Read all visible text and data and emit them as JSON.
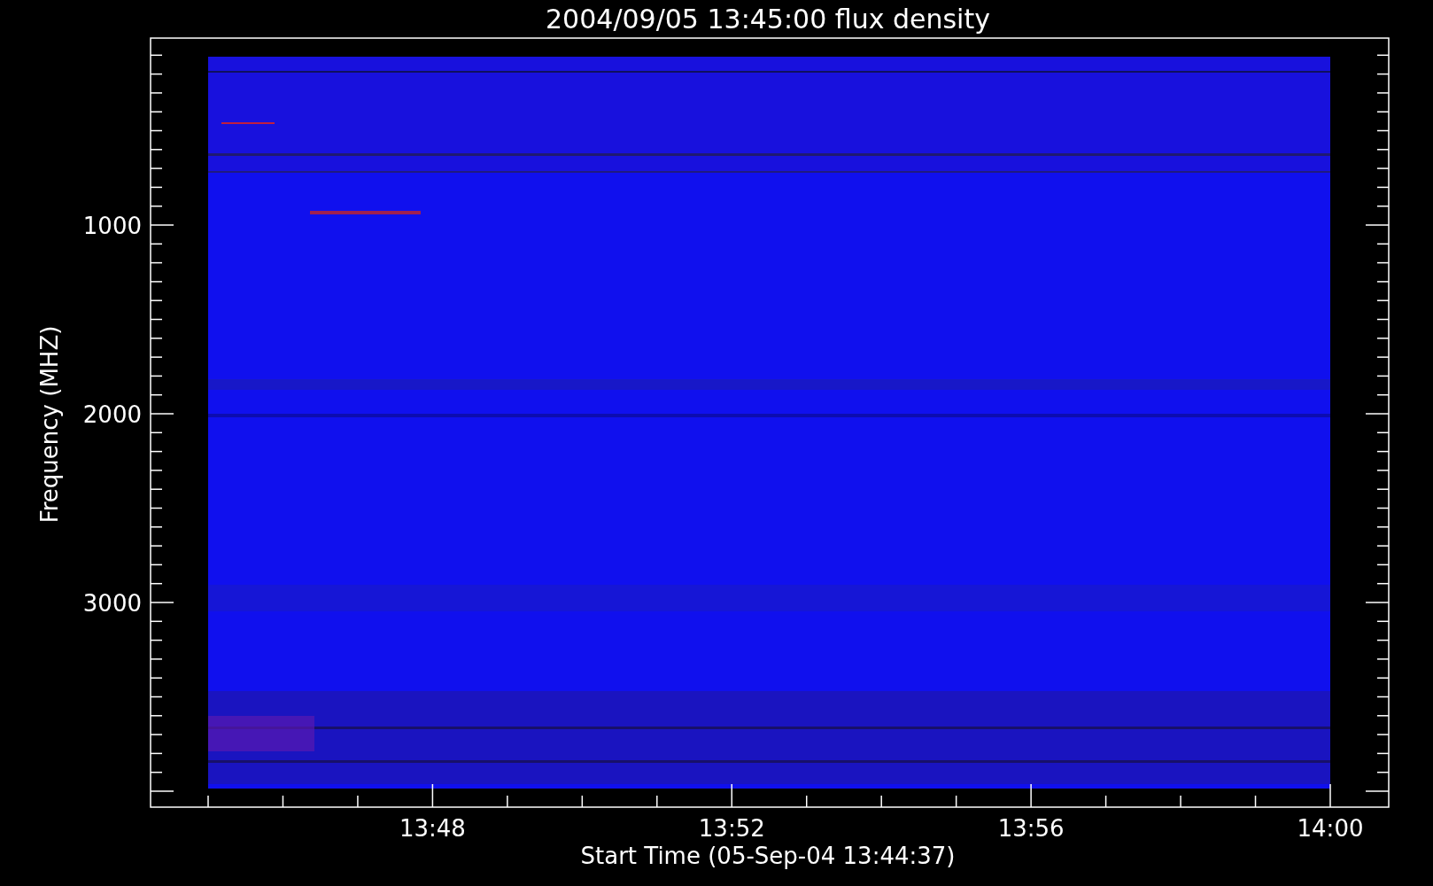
{
  "plot": {
    "title": "2004/09/05 13:45:00 flux density",
    "ylabel": "Frequency (MHZ)",
    "xlabel": "Start Time (05-Sep-04 13:44:37)",
    "yticks": [
      "1000",
      "2000",
      "3000"
    ],
    "xticks": [
      "13:48",
      "13:52",
      "13:56",
      "14:00"
    ]
  }
}
